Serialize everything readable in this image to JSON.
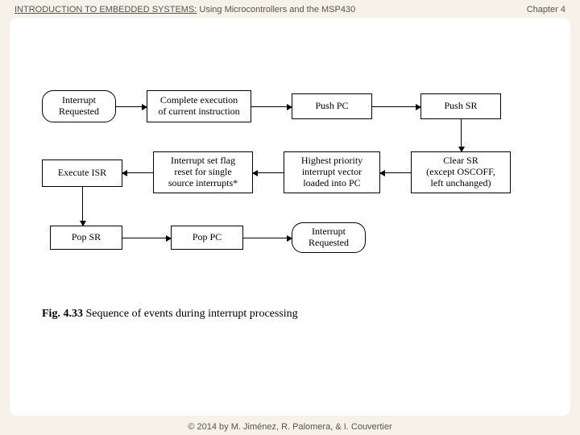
{
  "header": {
    "book_title_prefix": "INTRODUCTION TO EMBEDDED SYSTEMS:",
    "book_title_suffix": " Using Microcontrollers and the MSP430",
    "chapter": "Chapter 4"
  },
  "boxes": {
    "b1": "Interrupt\nRequested",
    "b2": "Complete execution\nof current instruction",
    "b3": "Push PC",
    "b4": "Push SR",
    "b5": "Clear SR\n(except OSCOFF,\nleft unchanged)",
    "b6": "Highest priority\ninterrupt vector\nloaded into PC",
    "b7": "Interrupt set flag\nreset for single\nsource interrupts*",
    "b8": "Execute ISR",
    "b9": "Pop SR",
    "b10": "Pop PC",
    "b11": "Interrupt\nRequested"
  },
  "caption": {
    "label": "Fig. 4.33",
    "text": "  Sequence of events during interrupt processing"
  },
  "footer": "© 2014 by M. Jiménez, R. Palomera, & I. Couvertier"
}
